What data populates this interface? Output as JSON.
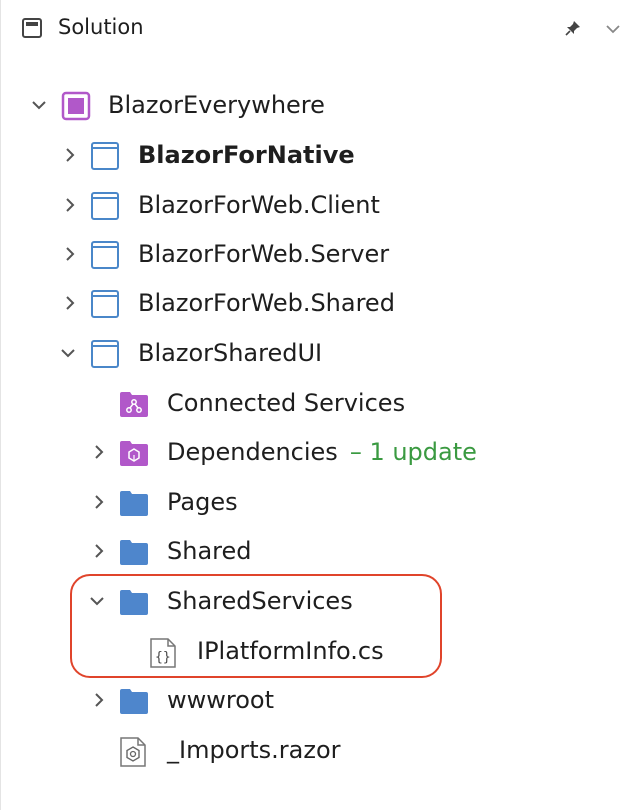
{
  "header": {
    "title": "Solution",
    "icons": [
      "solution-panel-icon",
      "pin-icon",
      "chevron-down-icon"
    ]
  },
  "tree": {
    "root": {
      "label": "BlazorEverywhere",
      "expanded": true,
      "icon": "solution-icon"
    },
    "projects": [
      {
        "label": "BlazorForNative",
        "bold": true,
        "expanded": false,
        "icon": "project-icon"
      },
      {
        "label": "BlazorForWeb.Client",
        "expanded": false,
        "icon": "project-icon"
      },
      {
        "label": "BlazorForWeb.Server",
        "expanded": false,
        "icon": "project-icon"
      },
      {
        "label": "BlazorForWeb.Shared",
        "expanded": false,
        "icon": "project-icon"
      },
      {
        "label": "BlazorSharedUI",
        "expanded": true,
        "icon": "project-icon"
      }
    ],
    "children": [
      {
        "label": "Connected Services",
        "icon": "connected-services-icon"
      },
      {
        "label": "Dependencies",
        "badge": "– 1 update",
        "expanded": false,
        "icon": "dependencies-icon"
      },
      {
        "label": "Pages",
        "expanded": false,
        "icon": "folder-icon"
      },
      {
        "label": "Shared",
        "expanded": false,
        "icon": "folder-icon"
      },
      {
        "label": "SharedServices",
        "expanded": true,
        "icon": "folder-icon"
      },
      {
        "label": "IPlatformInfo.cs",
        "icon": "csharp-file-icon"
      },
      {
        "label": "wwwroot",
        "expanded": false,
        "icon": "folder-icon"
      },
      {
        "label": "_Imports.razor",
        "icon": "razor-file-icon"
      }
    ]
  },
  "colors": {
    "accent_purple": "#b158c9",
    "project_blue": "#4a87c9",
    "folder_blue": "#4e86cc",
    "update_green": "#3a9a41",
    "highlight_red": "#e0442b"
  }
}
